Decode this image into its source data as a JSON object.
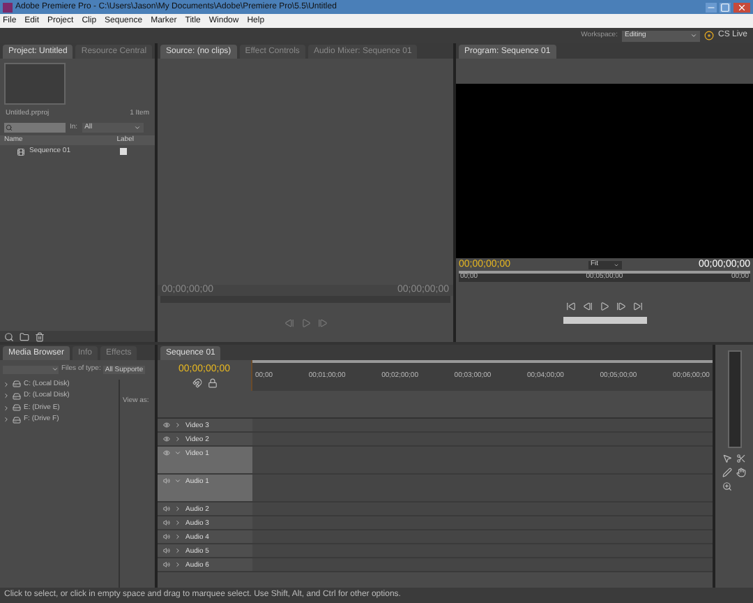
{
  "window": {
    "title": "Adobe Premiere Pro - C:\\Users\\Jason\\My Documents\\Adobe\\Premiere Pro\\5.5\\Untitled"
  },
  "menu": [
    "File",
    "Edit",
    "Project",
    "Clip",
    "Sequence",
    "Marker",
    "Title",
    "Window",
    "Help"
  ],
  "workspace": {
    "label": "Workspace:",
    "value": "Editing",
    "cs_live": "CS Live"
  },
  "project": {
    "tabs": [
      {
        "label": "Project: Untitled",
        "selected": true
      },
      {
        "label": "Resource Central",
        "selected": false
      }
    ],
    "file": "Untitled.prproj",
    "count": "1 Item",
    "in_label": "In:",
    "in_value": "All",
    "columns": [
      "Name",
      "Label"
    ],
    "items": [
      {
        "name": "Sequence 01"
      }
    ]
  },
  "source": {
    "tabs": [
      {
        "label": "Source: (no clips)",
        "selected": true
      },
      {
        "label": "Effect Controls",
        "selected": false
      },
      {
        "label": "Audio Mixer: Sequence 01",
        "selected": false
      }
    ],
    "timecode_left": "00;00;00;00",
    "timecode_right": "00;00;00;00"
  },
  "program": {
    "tabs": [
      {
        "label": "Program: Sequence 01",
        "selected": true
      }
    ],
    "timecode": "00;00;00;00",
    "fit": "Fit",
    "duration": "00;00;00;00",
    "ruler": [
      "00;00",
      "00;05;00;00",
      "00;00"
    ]
  },
  "browser": {
    "tabs": [
      {
        "label": "Media Browser",
        "selected": true
      },
      {
        "label": "Info",
        "selected": false
      },
      {
        "label": "Effects",
        "selected": false
      }
    ],
    "files_label": "Files of type:",
    "files_value": "All Supporte",
    "view_label": "View as:",
    "drives": [
      "C: (Local Disk)",
      "D: (Local Disk)",
      "E: (Drive E)",
      "F: (Drive F)"
    ]
  },
  "timeline": {
    "tabs": [
      {
        "label": "Sequence 01",
        "selected": true
      }
    ],
    "timecode": "00;00;00;00",
    "ruler": [
      "00;00",
      "00;01;00;00",
      "00;02;00;00",
      "00;03;00;00",
      "00;04;00;00",
      "00;05;00;00",
      "00;06;00;00"
    ],
    "tracks": [
      {
        "name": "Video 3",
        "kind": "video",
        "expanded": false
      },
      {
        "name": "Video 2",
        "kind": "video",
        "expanded": false
      },
      {
        "name": "Video 1",
        "kind": "video",
        "expanded": true
      },
      {
        "name": "Audio 1",
        "kind": "audio",
        "expanded": true
      },
      {
        "name": "Audio 2",
        "kind": "audio",
        "expanded": false
      },
      {
        "name": "Audio 3",
        "kind": "audio",
        "expanded": false
      },
      {
        "name": "Audio 4",
        "kind": "audio",
        "expanded": false
      },
      {
        "name": "Audio 5",
        "kind": "audio",
        "expanded": false
      },
      {
        "name": "Audio 6",
        "kind": "audio",
        "expanded": false
      }
    ]
  },
  "status_bar": "Click to select, or click in empty space and drag to marquee select. Use Shift, Alt, and Ctrl for other options."
}
